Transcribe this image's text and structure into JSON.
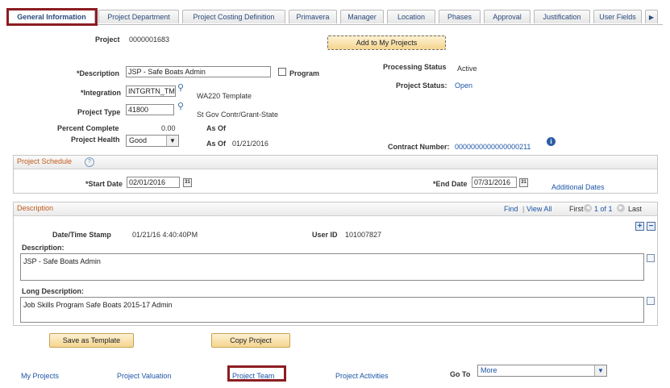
{
  "tabs": [
    {
      "label": "General Information",
      "active": true
    },
    {
      "label": "Project Department"
    },
    {
      "label": "Project Costing Definition"
    },
    {
      "label": "Primavera"
    },
    {
      "label": "Manager"
    },
    {
      "label": "Location"
    },
    {
      "label": "Phases"
    },
    {
      "label": "Approval"
    },
    {
      "label": "Justification"
    },
    {
      "label": "User Fields"
    }
  ],
  "header": {
    "project_label": "Project",
    "project_value": "0000001683",
    "add_button": "Add to My Projects",
    "description_label": "*Description",
    "description_value": "JSP - Safe Boats Admin",
    "program_label": "Program",
    "processing_status_label": "Processing Status",
    "processing_status_value": "Active",
    "integration_label": "*Integration",
    "integration_value": "INTGRTN_TM",
    "integration_desc": "WA220 Template",
    "project_status_label": "Project Status:",
    "project_status_value": "Open",
    "project_type_label": "Project Type",
    "project_type_value": "41800",
    "project_type_desc": "St Gov Contr/Grant-State",
    "percent_complete_label": "Percent Complete",
    "percent_complete_value": "0.00",
    "as_of_label_1": "As Of",
    "project_health_label": "Project Health",
    "project_health_value": "Good",
    "as_of_label_2": "As Of",
    "as_of_date": "01/21/2016",
    "contract_number_label": "Contract Number:",
    "contract_number_value": "0000000000000000211"
  },
  "schedule": {
    "title": "Project Schedule",
    "start_label": "*Start Date",
    "start_value": "02/01/2016",
    "end_label": "*End Date",
    "end_value": "07/31/2016",
    "additional_dates": "Additional Dates"
  },
  "description_section": {
    "title": "Description",
    "find": "Find",
    "separator": "|",
    "view_all": "View All",
    "first": "First",
    "paging": "1 of 1",
    "last": "Last",
    "datetime_label": "Date/Time Stamp",
    "datetime_value": "01/21/16  4:40:40PM",
    "userid_label": "User ID",
    "userid_value": "101007827",
    "desc_label": "Description:",
    "desc_value": "JSP - Safe Boats Admin",
    "long_desc_label": "Long Description:",
    "long_desc_value": "Job Skills Program Safe Boats 2015-17 Admin"
  },
  "buttons": {
    "save_template": "Save as Template",
    "copy_project": "Copy Project"
  },
  "footer": {
    "my_projects": "My Projects",
    "project_valuation": "Project Valuation",
    "project_team": "Project Team",
    "project_activities": "Project Activities",
    "go_to_label": "Go To",
    "go_to_value": "More"
  },
  "colors": {
    "highlight": "#8c1d22",
    "link": "#1d55a6",
    "section_title": "#c05a1c",
    "button": "#f5d58e"
  }
}
